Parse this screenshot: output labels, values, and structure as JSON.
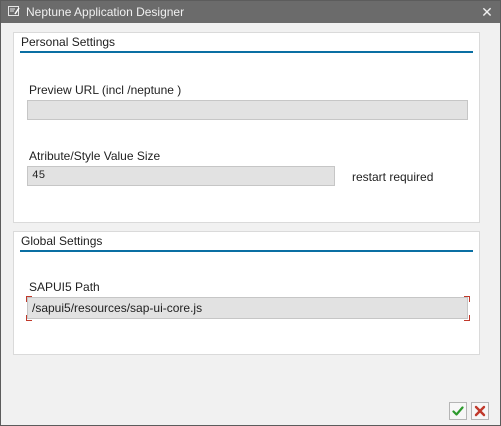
{
  "window": {
    "title": "Neptune Application Designer",
    "title_icon": "edit-window-icon",
    "close_glyph": "✕"
  },
  "personal": {
    "title": "Personal Settings",
    "preview_url_label": "Preview URL (incl /neptune )",
    "preview_url_value": "",
    "style_size_label": "Atribute/Style Value Size",
    "style_size_value": "45",
    "restart_note": "restart required"
  },
  "global": {
    "title": "Global Settings",
    "sapui5_label": "SAPUI5 Path",
    "sapui5_value": "/sapui5/resources/sap-ui-core.js"
  },
  "footer": {
    "ok_icon": "checkmark-icon",
    "cancel_icon": "cancel-icon"
  },
  "colors": {
    "accent": "#0a6fa3",
    "ok": "#2d9a2d",
    "cancel": "#c0392b"
  }
}
